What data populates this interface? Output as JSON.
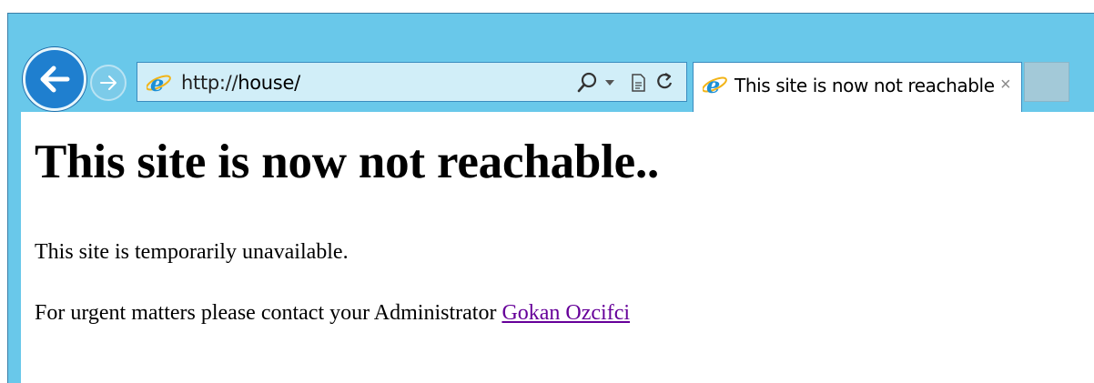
{
  "browser": {
    "address_bar": {
      "url_prefix": "http://",
      "url_host": "house/"
    },
    "tab": {
      "title": "This site is now not reachable",
      "close_glyph": "×"
    },
    "icons": {
      "back": "back-arrow-icon",
      "forward": "forward-arrow-icon",
      "page": "internet-explorer-icon",
      "search": "search-icon",
      "dropdown": "chevron-down-icon",
      "compat": "compatibility-view-icon",
      "refresh": "refresh-icon"
    }
  },
  "page": {
    "heading": "This site is now not reachable..",
    "paragraph1": "This site is temporarily unavailable.",
    "paragraph2_text": "For urgent matters please contact your Administrator",
    "admin_link": "Gokan Ozcifci"
  },
  "colors": {
    "chrome": "#69c8ea",
    "back_button": "#1f7fcf",
    "link_visited": "#660099"
  }
}
